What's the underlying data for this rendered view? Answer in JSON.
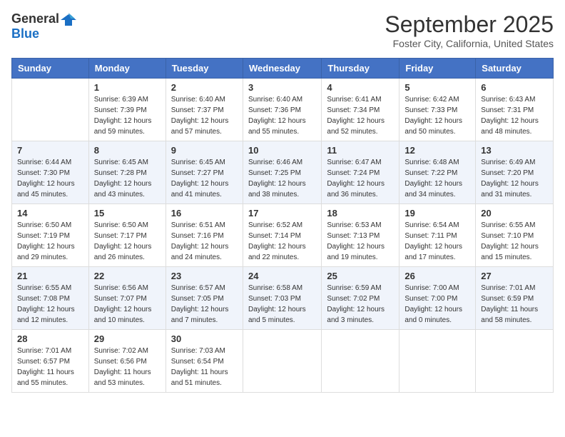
{
  "header": {
    "logo_general": "General",
    "logo_blue": "Blue",
    "month": "September 2025",
    "location": "Foster City, California, United States"
  },
  "days_of_week": [
    "Sunday",
    "Monday",
    "Tuesday",
    "Wednesday",
    "Thursday",
    "Friday",
    "Saturday"
  ],
  "weeks": [
    [
      {
        "day": "",
        "sunrise": "",
        "sunset": "",
        "daylight": ""
      },
      {
        "day": "1",
        "sunrise": "Sunrise: 6:39 AM",
        "sunset": "Sunset: 7:39 PM",
        "daylight": "Daylight: 12 hours and 59 minutes."
      },
      {
        "day": "2",
        "sunrise": "Sunrise: 6:40 AM",
        "sunset": "Sunset: 7:37 PM",
        "daylight": "Daylight: 12 hours and 57 minutes."
      },
      {
        "day": "3",
        "sunrise": "Sunrise: 6:40 AM",
        "sunset": "Sunset: 7:36 PM",
        "daylight": "Daylight: 12 hours and 55 minutes."
      },
      {
        "day": "4",
        "sunrise": "Sunrise: 6:41 AM",
        "sunset": "Sunset: 7:34 PM",
        "daylight": "Daylight: 12 hours and 52 minutes."
      },
      {
        "day": "5",
        "sunrise": "Sunrise: 6:42 AM",
        "sunset": "Sunset: 7:33 PM",
        "daylight": "Daylight: 12 hours and 50 minutes."
      },
      {
        "day": "6",
        "sunrise": "Sunrise: 6:43 AM",
        "sunset": "Sunset: 7:31 PM",
        "daylight": "Daylight: 12 hours and 48 minutes."
      }
    ],
    [
      {
        "day": "7",
        "sunrise": "Sunrise: 6:44 AM",
        "sunset": "Sunset: 7:30 PM",
        "daylight": "Daylight: 12 hours and 45 minutes."
      },
      {
        "day": "8",
        "sunrise": "Sunrise: 6:45 AM",
        "sunset": "Sunset: 7:28 PM",
        "daylight": "Daylight: 12 hours and 43 minutes."
      },
      {
        "day": "9",
        "sunrise": "Sunrise: 6:45 AM",
        "sunset": "Sunset: 7:27 PM",
        "daylight": "Daylight: 12 hours and 41 minutes."
      },
      {
        "day": "10",
        "sunrise": "Sunrise: 6:46 AM",
        "sunset": "Sunset: 7:25 PM",
        "daylight": "Daylight: 12 hours and 38 minutes."
      },
      {
        "day": "11",
        "sunrise": "Sunrise: 6:47 AM",
        "sunset": "Sunset: 7:24 PM",
        "daylight": "Daylight: 12 hours and 36 minutes."
      },
      {
        "day": "12",
        "sunrise": "Sunrise: 6:48 AM",
        "sunset": "Sunset: 7:22 PM",
        "daylight": "Daylight: 12 hours and 34 minutes."
      },
      {
        "day": "13",
        "sunrise": "Sunrise: 6:49 AM",
        "sunset": "Sunset: 7:20 PM",
        "daylight": "Daylight: 12 hours and 31 minutes."
      }
    ],
    [
      {
        "day": "14",
        "sunrise": "Sunrise: 6:50 AM",
        "sunset": "Sunset: 7:19 PM",
        "daylight": "Daylight: 12 hours and 29 minutes."
      },
      {
        "day": "15",
        "sunrise": "Sunrise: 6:50 AM",
        "sunset": "Sunset: 7:17 PM",
        "daylight": "Daylight: 12 hours and 26 minutes."
      },
      {
        "day": "16",
        "sunrise": "Sunrise: 6:51 AM",
        "sunset": "Sunset: 7:16 PM",
        "daylight": "Daylight: 12 hours and 24 minutes."
      },
      {
        "day": "17",
        "sunrise": "Sunrise: 6:52 AM",
        "sunset": "Sunset: 7:14 PM",
        "daylight": "Daylight: 12 hours and 22 minutes."
      },
      {
        "day": "18",
        "sunrise": "Sunrise: 6:53 AM",
        "sunset": "Sunset: 7:13 PM",
        "daylight": "Daylight: 12 hours and 19 minutes."
      },
      {
        "day": "19",
        "sunrise": "Sunrise: 6:54 AM",
        "sunset": "Sunset: 7:11 PM",
        "daylight": "Daylight: 12 hours and 17 minutes."
      },
      {
        "day": "20",
        "sunrise": "Sunrise: 6:55 AM",
        "sunset": "Sunset: 7:10 PM",
        "daylight": "Daylight: 12 hours and 15 minutes."
      }
    ],
    [
      {
        "day": "21",
        "sunrise": "Sunrise: 6:55 AM",
        "sunset": "Sunset: 7:08 PM",
        "daylight": "Daylight: 12 hours and 12 minutes."
      },
      {
        "day": "22",
        "sunrise": "Sunrise: 6:56 AM",
        "sunset": "Sunset: 7:07 PM",
        "daylight": "Daylight: 12 hours and 10 minutes."
      },
      {
        "day": "23",
        "sunrise": "Sunrise: 6:57 AM",
        "sunset": "Sunset: 7:05 PM",
        "daylight": "Daylight: 12 hours and 7 minutes."
      },
      {
        "day": "24",
        "sunrise": "Sunrise: 6:58 AM",
        "sunset": "Sunset: 7:03 PM",
        "daylight": "Daylight: 12 hours and 5 minutes."
      },
      {
        "day": "25",
        "sunrise": "Sunrise: 6:59 AM",
        "sunset": "Sunset: 7:02 PM",
        "daylight": "Daylight: 12 hours and 3 minutes."
      },
      {
        "day": "26",
        "sunrise": "Sunrise: 7:00 AM",
        "sunset": "Sunset: 7:00 PM",
        "daylight": "Daylight: 12 hours and 0 minutes."
      },
      {
        "day": "27",
        "sunrise": "Sunrise: 7:01 AM",
        "sunset": "Sunset: 6:59 PM",
        "daylight": "Daylight: 11 hours and 58 minutes."
      }
    ],
    [
      {
        "day": "28",
        "sunrise": "Sunrise: 7:01 AM",
        "sunset": "Sunset: 6:57 PM",
        "daylight": "Daylight: 11 hours and 55 minutes."
      },
      {
        "day": "29",
        "sunrise": "Sunrise: 7:02 AM",
        "sunset": "Sunset: 6:56 PM",
        "daylight": "Daylight: 11 hours and 53 minutes."
      },
      {
        "day": "30",
        "sunrise": "Sunrise: 7:03 AM",
        "sunset": "Sunset: 6:54 PM",
        "daylight": "Daylight: 11 hours and 51 minutes."
      },
      {
        "day": "",
        "sunrise": "",
        "sunset": "",
        "daylight": ""
      },
      {
        "day": "",
        "sunrise": "",
        "sunset": "",
        "daylight": ""
      },
      {
        "day": "",
        "sunrise": "",
        "sunset": "",
        "daylight": ""
      },
      {
        "day": "",
        "sunrise": "",
        "sunset": "",
        "daylight": ""
      }
    ]
  ]
}
